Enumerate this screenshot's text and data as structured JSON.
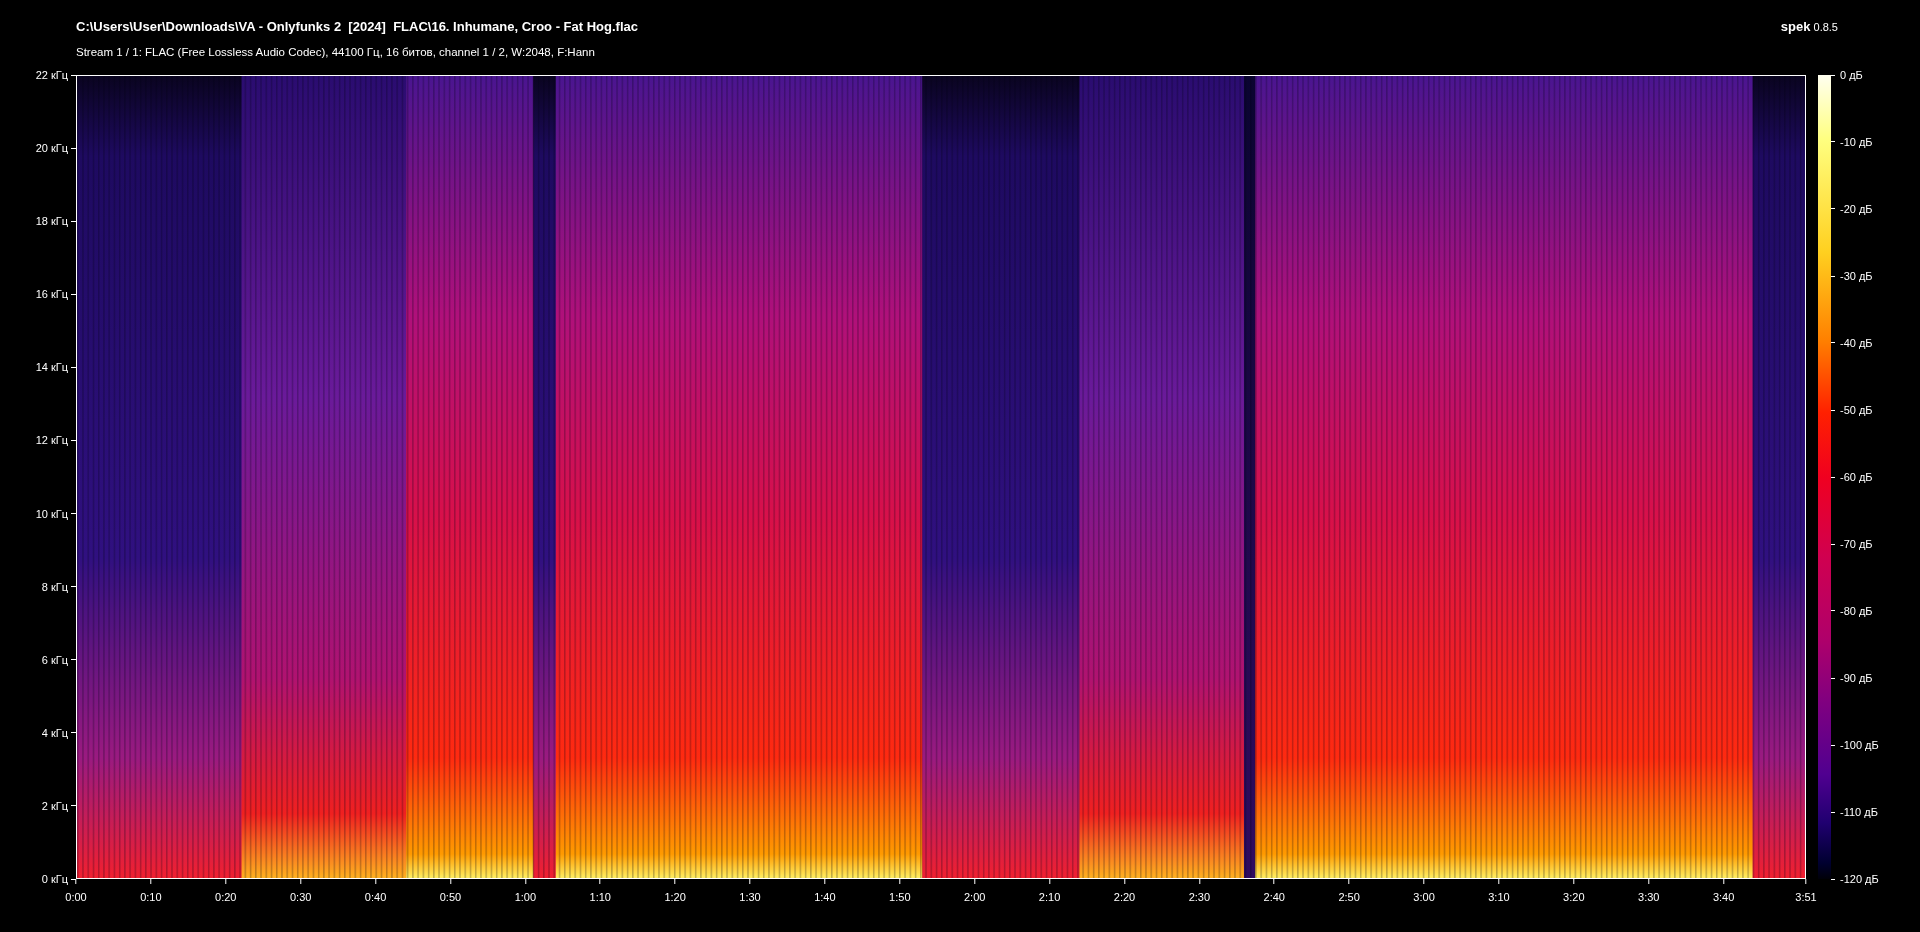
{
  "title": "C:\\Users\\User\\Downloads\\VA - Onlyfunks 2  [2024]  FLAC\\16. Inhumane, Croo - Fat Hog.flac",
  "stream_info": "Stream 1 / 1: FLAC (Free Lossless Audio Codec), 44100 Гц, 16 битов, channel 1 / 2, W:2048, F:Hann",
  "app_name": "spek",
  "app_version": "0.8.5",
  "frequency_axis": [
    "22 кГц",
    "20 кГц",
    "18 кГц",
    "16 кГц",
    "14 кГц",
    "12 кГц",
    "10 кГц",
    "8 кГц",
    "6 кГц",
    "4 кГц",
    "2 кГц",
    "0 кГц"
  ],
  "time_axis": [
    "0:00",
    "0:10",
    "0:20",
    "0:30",
    "0:40",
    "0:50",
    "1:00",
    "1:10",
    "1:20",
    "1:30",
    "1:40",
    "1:50",
    "2:00",
    "2:10",
    "2:20",
    "2:30",
    "2:40",
    "2:50",
    "3:00",
    "3:10",
    "3:20",
    "3:30",
    "3:40",
    "3:51"
  ],
  "level_scale": [
    "0 дБ",
    "-10 дБ",
    "-20 дБ",
    "-30 дБ",
    "-40 дБ",
    "-50 дБ",
    "-60 дБ",
    "-70 дБ",
    "-80 дБ",
    "-90 дБ",
    "-100 дБ",
    "-110 дБ",
    "-120 дБ"
  ]
}
